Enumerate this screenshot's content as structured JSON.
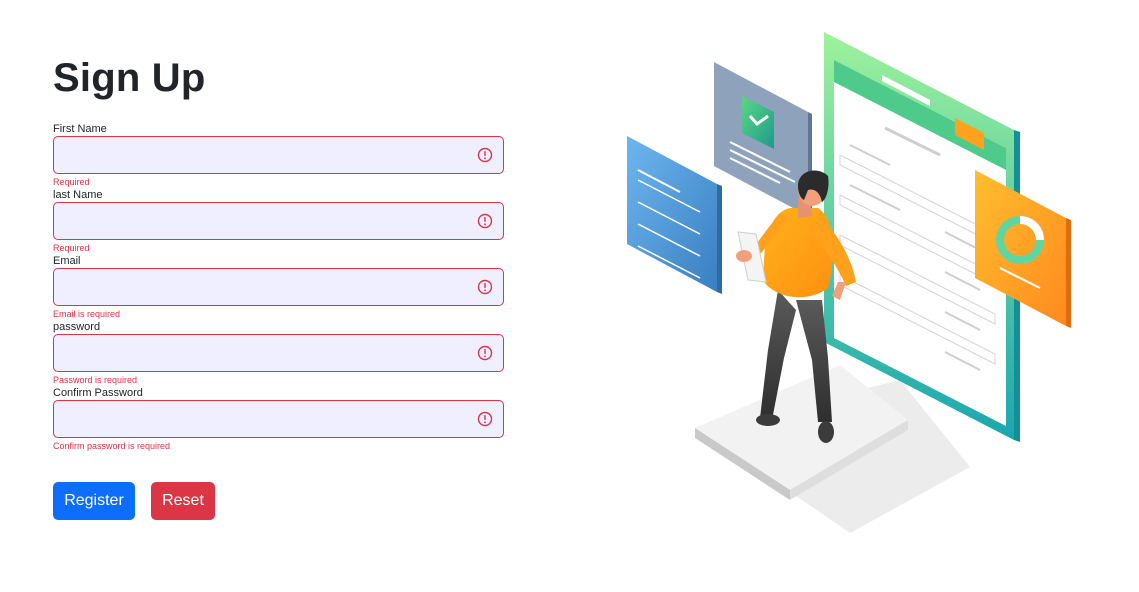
{
  "title": "Sign Up",
  "fields": [
    {
      "label": "First Name",
      "value": "",
      "error": "Required"
    },
    {
      "label": "last Name",
      "value": "",
      "error": "Required"
    },
    {
      "label": "Email",
      "value": "",
      "error": "Email is required"
    },
    {
      "label": "password",
      "value": "",
      "error": "Password is required"
    },
    {
      "label": "Confirm Password",
      "value": "",
      "error": "Confirm password is required"
    }
  ],
  "buttons": {
    "register": "Register",
    "reset": "Reset"
  },
  "icons": {
    "invalid": "exclamation-circle-icon"
  },
  "colors": {
    "primary": "#0d6efd",
    "danger": "#dc3545",
    "input_bg": "#f0efff"
  }
}
